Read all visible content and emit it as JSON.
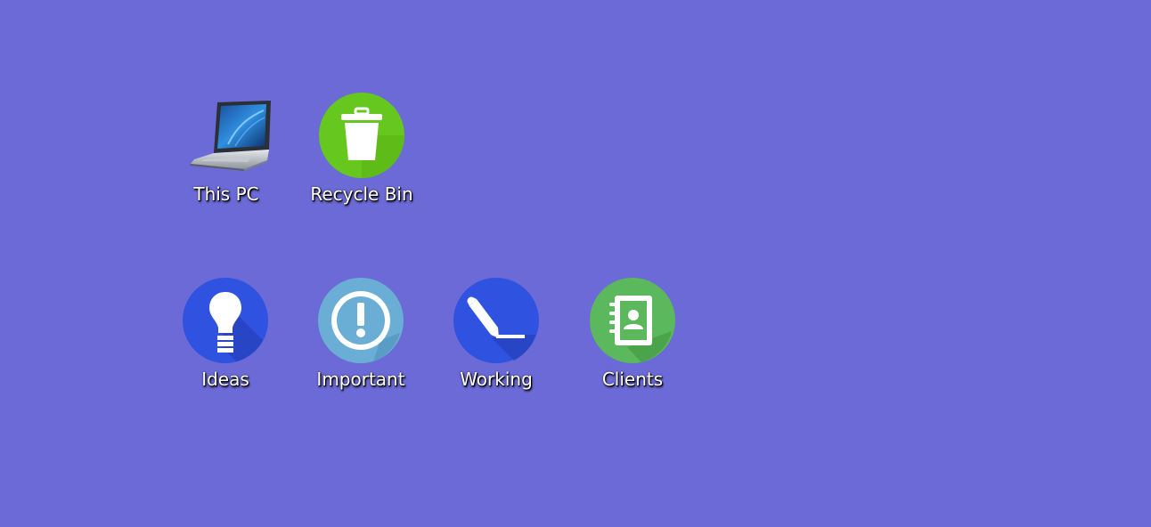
{
  "desktop": {
    "background_color": "#6b6ad6",
    "icons": [
      {
        "label": "This PC",
        "icon": "laptop-icon"
      },
      {
        "label": "Recycle Bin",
        "icon": "recycle-bin-icon",
        "color": "#66c81e"
      },
      {
        "label": "Ideas",
        "icon": "lightbulb-icon",
        "color": "#2f52e0"
      },
      {
        "label": "Important",
        "icon": "exclamation-icon",
        "color": "#6aaed6"
      },
      {
        "label": "Working",
        "icon": "pencil-icon",
        "color": "#2f52e0"
      },
      {
        "label": "Clients",
        "icon": "address-book-icon",
        "color": "#5cb85c"
      }
    ]
  }
}
